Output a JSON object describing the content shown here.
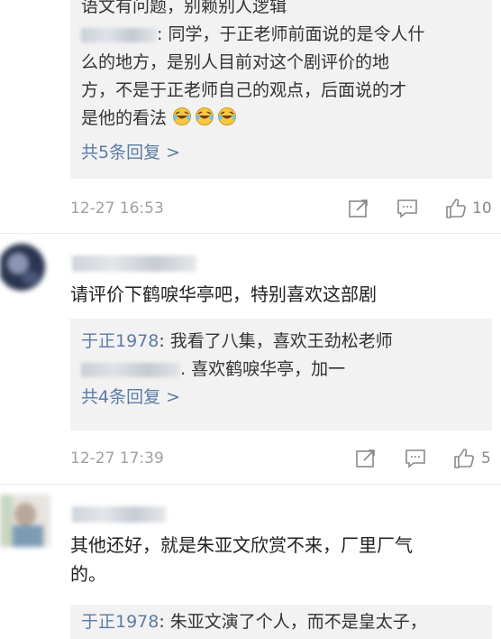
{
  "comments": [
    {
      "replies": [
        {
          "prefix": "",
          "text": "语文有问题，别赖别人逻辑"
        },
        {
          "author": "",
          "text": ": 同学，于正老师前面说的是令人什"
        },
        {
          "text": "么的地方，是别人目前对这个剧评价的地"
        },
        {
          "text": "方，不是于正老师自己的观点，后面说的才"
        },
        {
          "text": "是他的看法"
        }
      ],
      "more_replies": "共5条回复 >",
      "time": "12-27 16:53",
      "likes": "10",
      "emoji": "laughing-tears"
    },
    {
      "text": "请评价下鹤唳华亭吧，特别喜欢这部剧",
      "replies": [
        {
          "author": "于正1978",
          "text": ": 我看了八集，喜欢王劲松老师"
        },
        {
          "author": "",
          "text": ". 喜欢鹤唳华亭，加一"
        }
      ],
      "more_replies": "共4条回复 >",
      "time": "12-27 17:39",
      "likes": "5"
    },
    {
      "text_line1": "其他还好，就是朱亚文欣赏不来，厂里厂气",
      "text_line2": "的。",
      "replies": [
        {
          "author": "于正1978",
          "text": ": 朱亚文演了个人，而不是皇太子，"
        }
      ]
    }
  ],
  "icons": {
    "share": "share-icon",
    "comment": "comment-icon",
    "like": "thumbs-up-icon"
  }
}
